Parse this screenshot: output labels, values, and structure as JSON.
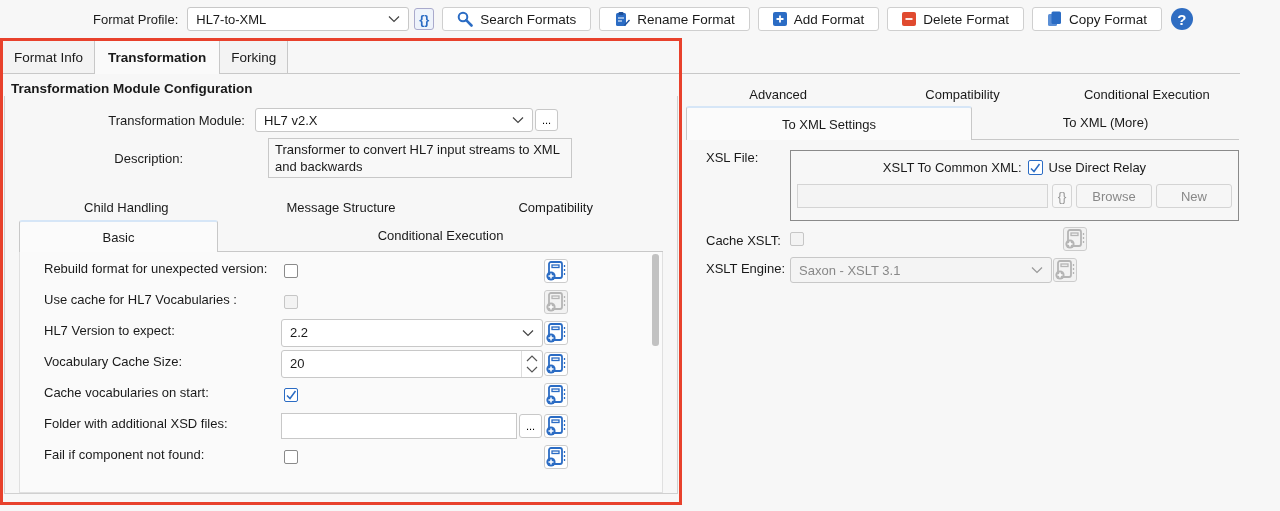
{
  "toolbar": {
    "profile_label": "Format Profile:",
    "profile_value": "HL7-to-XML",
    "braces_button": "{}",
    "buttons": [
      {
        "label": "Search Formats",
        "kind": "search"
      },
      {
        "label": "Rename Format",
        "kind": "rename"
      },
      {
        "label": "Add Format",
        "kind": "add"
      },
      {
        "label": "Delete Format",
        "kind": "delete"
      },
      {
        "label": "Copy Format",
        "kind": "copy"
      }
    ],
    "help_button": "?"
  },
  "left_panel": {
    "tabs": [
      {
        "label": "Format Info",
        "selected": false
      },
      {
        "label": "Transformation",
        "selected": true
      },
      {
        "label": "Forking",
        "selected": false
      }
    ],
    "section_title": "Transformation Module Configuration",
    "module": {
      "label": "Transformation Module:",
      "value": "HL7 v2.X",
      "browse_button": "..."
    },
    "description": {
      "label": "Description:",
      "value": "Transformer to convert HL7 input streams to XML and backwards"
    },
    "subtabs_row_1": [
      {
        "label": "Child Handling",
        "selected": false
      },
      {
        "label": "Message Structure",
        "selected": false
      },
      {
        "label": "Compatibility",
        "selected": false
      }
    ],
    "subtabs_row_2": [
      {
        "label": "Basic",
        "selected": true
      },
      {
        "label": "Conditional Execution",
        "selected": false
      }
    ],
    "settings": [
      {
        "kind": "checkbox",
        "label": "Rebuild format for unexpected version:",
        "checked": false,
        "disabled": false
      },
      {
        "kind": "checkbox",
        "label": "Use cache for HL7 Vocabularies  :",
        "checked": false,
        "disabled": true
      },
      {
        "kind": "dropdown",
        "label": "HL7 Version to expect:",
        "value": "2.2",
        "disabled": false
      },
      {
        "kind": "spinner",
        "label": "Vocabulary Cache Size:",
        "value": "20",
        "disabled": false
      },
      {
        "kind": "checkbox",
        "label": "Cache vocabularies on start:",
        "checked": true,
        "disabled": false
      },
      {
        "kind": "folder",
        "label": "Folder with additional XSD files:",
        "button": "...",
        "disabled": false
      },
      {
        "kind": "checkbox",
        "label": "Fail if component not found:",
        "checked": false,
        "disabled": false
      }
    ]
  },
  "right_panel": {
    "tabs_row_1": [
      {
        "label": "Advanced",
        "selected": false
      },
      {
        "label": "Compatibility",
        "selected": false
      },
      {
        "label": "Conditional Execution",
        "selected": false
      }
    ],
    "tabs_row_2": [
      {
        "label": "To XML Settings",
        "selected": true
      },
      {
        "label": "To XML (More)",
        "selected": false
      }
    ],
    "xsl_file": {
      "label": "XSL File:",
      "group_label": "XSLT To Common XML:",
      "relay_label": "Use Direct Relay",
      "relay_checked": true,
      "braces_button": "{}",
      "buttons": [
        "Browse",
        "New"
      ]
    },
    "cache_xslt": {
      "label": "Cache XSLT:",
      "checked": false,
      "disabled": true
    },
    "xslt_engine": {
      "label": "XSLT Engine:",
      "value": "Saxon - XSLT 3.1",
      "disabled": true
    }
  }
}
